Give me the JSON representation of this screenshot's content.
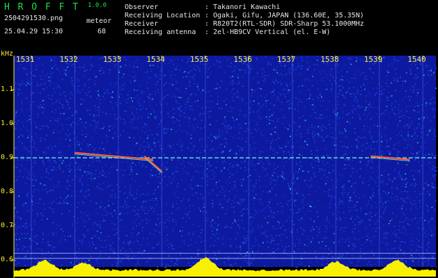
{
  "app": {
    "title": "H R O F F T",
    "version": "1.0.0",
    "filename": "2504291530.png",
    "timestamp": "25.04.29 15:30",
    "count_label": "meteor",
    "count_value": "68"
  },
  "info": {
    "rows": [
      {
        "label": "Observer",
        "sep": ":",
        "value": "Takanori Kawachi"
      },
      {
        "label": "Receiving Location",
        "sep": ":",
        "value": "Ogaki, Gifu, JAPAN (136.60E, 35.35N)"
      },
      {
        "label": "Receiver",
        "sep": ":",
        "value": "R820T2(RTL-SDR) SDR-Sharp 53.1000MHz"
      },
      {
        "label": "Receiving antenna",
        "sep": ":",
        "value": "2el-HB9CV Vertical (el. E-W)"
      }
    ]
  },
  "colors": {
    "background": "#000000",
    "header_green": "#19e34a",
    "label_yellow": "#ffee2e",
    "plot_blue": "#0d1aa0",
    "power_yellow": "#f7f000",
    "power_cyan": "#20d8f0"
  },
  "chart_data": {
    "type": "heatmap",
    "ylabel": "kHz",
    "y_ticks": [
      "1.1",
      "1.0",
      "0.9",
      "0.8",
      "0.7",
      "0.6"
    ],
    "y_tick_values": [
      1.1,
      1.0,
      0.9,
      0.8,
      0.7,
      0.6
    ],
    "x_ticks": [
      "1531",
      "1532",
      "1533",
      "1534",
      "1535",
      "1536",
      "1537",
      "1538",
      "1539",
      "1540"
    ],
    "x_tick_values": [
      1531,
      1532,
      1533,
      1534,
      1535,
      1536,
      1537,
      1538,
      1539,
      1540
    ],
    "xlim": [
      1530.6,
      1540.3
    ],
    "ylim": [
      0.58,
      1.2
    ],
    "carrier_khz": 0.9,
    "meteor_traces": [
      {
        "x0": 1532.0,
        "x1": 1533.8,
        "y0": 0.915,
        "y1": 0.895
      },
      {
        "x0": 1533.6,
        "x1": 1534.0,
        "y0": 0.905,
        "y1": 0.86
      },
      {
        "x0": 1538.8,
        "x1": 1539.7,
        "y0": 0.905,
        "y1": 0.895
      }
    ]
  }
}
